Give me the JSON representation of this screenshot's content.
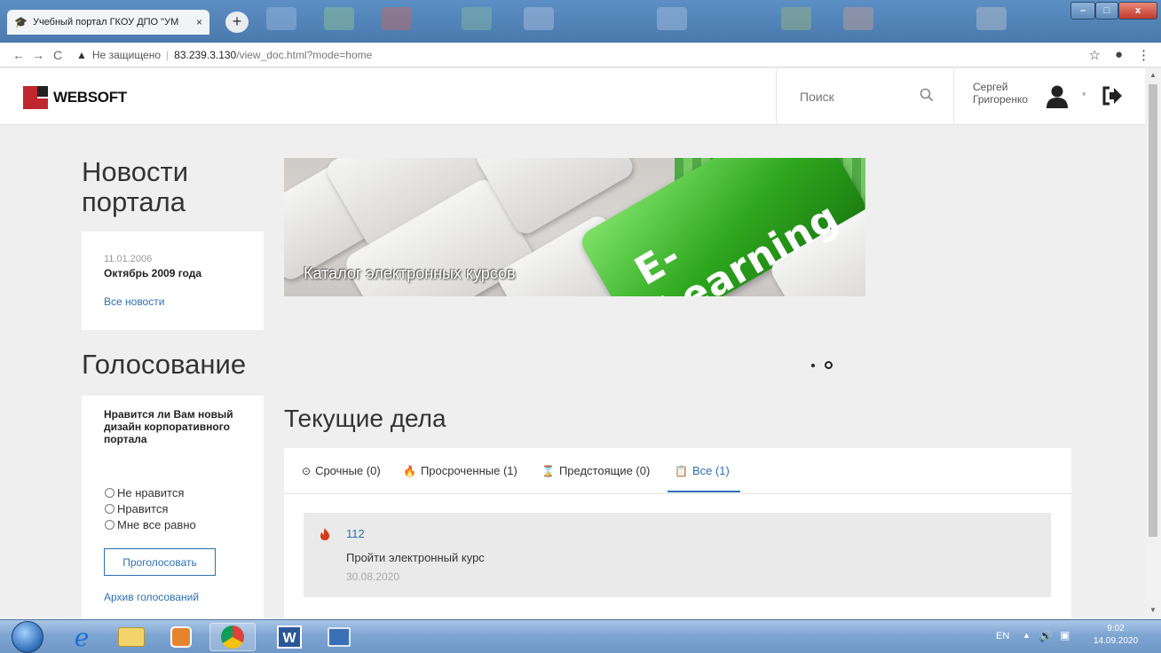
{
  "browser": {
    "tab_title": "Учебный портал ГКОУ ДПО \"УМ",
    "tab_close": "×",
    "new_tab": "+",
    "security_label": "Не защищено",
    "url_host": "83.239.3.130",
    "url_path": "/view_doc.html?mode=home",
    "window_controls": {
      "minimize": "–",
      "maximize": "□",
      "close": "x"
    }
  },
  "header": {
    "logo": "WEBSOFT",
    "search_placeholder": "Поиск",
    "user_first_name": "Сергей",
    "user_last_name": "Григоренко",
    "caret": "▾"
  },
  "news": {
    "heading": "Новости портала",
    "date": "11.01.2006",
    "title": "Октябрь 2009 года",
    "all_link": "Все новости"
  },
  "poll": {
    "heading": "Голосование",
    "question": "Нравится ли Вам новый дизайн корпоративного портала",
    "options": [
      "Не нравится",
      "Нравится",
      "Мне все равно"
    ],
    "vote_button": "Проголосовать",
    "archive_link": "Архив голосований"
  },
  "banner": {
    "title": "E-Learning",
    "caption": "Каталог электронных курсов",
    "active_slide": 2,
    "slide_count": 2
  },
  "tasks": {
    "heading": "Текущие дела",
    "tabs": [
      {
        "label": "Срочные (0)",
        "icon": "clock-icon"
      },
      {
        "label": "Просроченные (1)",
        "icon": "fire-icon"
      },
      {
        "label": "Предстоящие (0)",
        "icon": "hourglass-icon"
      },
      {
        "label": "Все (1)",
        "icon": "clipboard-icon"
      }
    ],
    "active_tab": 3,
    "items": [
      {
        "number": "112",
        "title": "Пройти электронный курс",
        "date": "30.08.2020",
        "icon": "fire-icon"
      }
    ]
  },
  "taskbar": {
    "language": "EN",
    "time": "9:02",
    "date": "14.09.2020"
  },
  "colors": {
    "accent": "#2c6fb5",
    "brand_red": "#c0272d",
    "page_bg": "#efefef",
    "overdue": "#d43a1a"
  }
}
